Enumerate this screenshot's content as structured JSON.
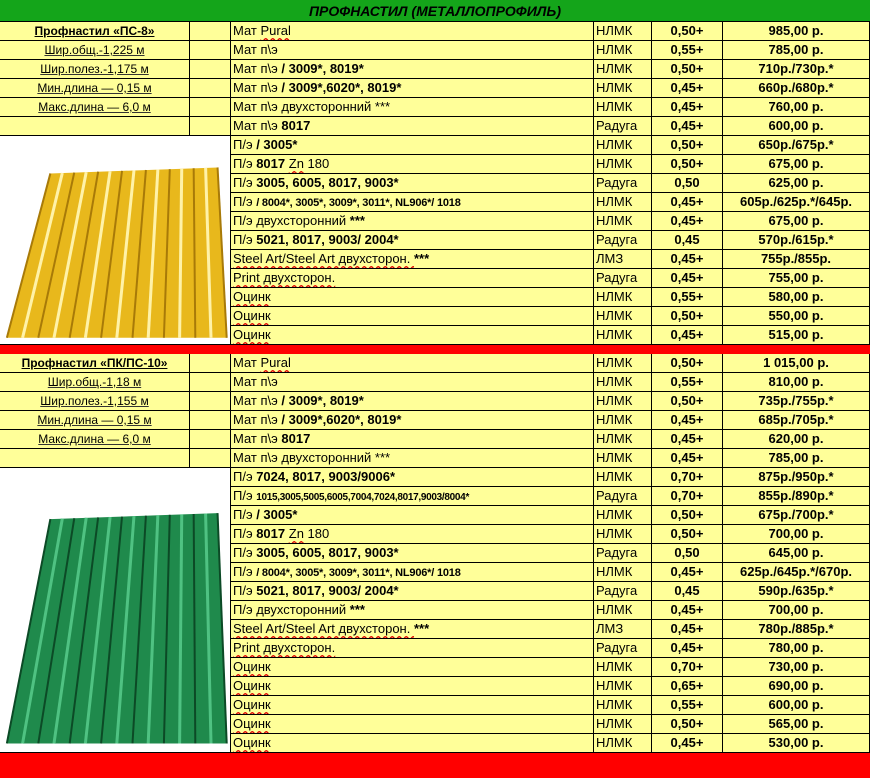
{
  "title": "ПРОФНАСТИЛ (МЕТАЛЛОПРОФИЛЬ)",
  "colors": {
    "green_header": "#14a51a",
    "cell_bg": "#ffff99",
    "separator": "#ff0000",
    "ps8_sheet": "#e8b81c",
    "pk10_sheet": "#1f8a4c"
  },
  "section1": {
    "params": [
      "Профнастил «ПС-8»",
      "Шир.общ.-1,225 м",
      "Шир.полез.-1,175 м",
      "Мин.длина — 0,15 м",
      "Макс.длина — 6,0 м"
    ],
    "image_icon": "yellow-corrugated-sheet",
    "rows": [
      {
        "p": "Мат ",
        "pu": "Pural",
        "b": "",
        "v": "НЛМК",
        "t": "0,50+",
        "price": "985,00 р."
      },
      {
        "p": "Мат п\\э",
        "b": "",
        "v": "НЛМК",
        "t": "0,55+",
        "price": "785,00 р."
      },
      {
        "p": "Мат п\\э ",
        "b": "/ 3009*, 8019*",
        "v": "НЛМК",
        "t": "0,50+",
        "price": "710р./730р.*"
      },
      {
        "p": "Мат п\\э ",
        "b": "/ 3009*,6020*, 8019*",
        "v": "НЛМК",
        "t": "0,45+",
        "price": "660р./680р.*"
      },
      {
        "p": "Мат п\\э двухсторонний ***",
        "b": "",
        "v": "НЛМК",
        "t": "0,45+",
        "price": "760,00 р."
      },
      {
        "p": "Мат п\\э ",
        "b": "8017",
        "v": "Радуга",
        "t": "0,45+",
        "price": "600,00 р."
      },
      {
        "p": "П/э ",
        "b": "/ 3005*",
        "v": "НЛМК",
        "t": "0,50+",
        "price": "650р./675р.*"
      },
      {
        "p": "П/э ",
        "b": "8017",
        "zn": "Zn",
        "tail": " 180",
        "v": "НЛМК",
        "t": "0,50+",
        "price": "675,00 р."
      },
      {
        "p": "П/э ",
        "b": "3005, 6005, 8017, 9003*",
        "v": "Радуга",
        "t": "0,50",
        "price": "625,00 р."
      },
      {
        "p": "П/э ",
        "b": "/ 8004*, 3005*, 3009*, 3011*, NL906*/ 1018",
        "small": true,
        "v": "НЛМК",
        "t": "0,45+",
        "price": "605р./625р.*/645р."
      },
      {
        "p": "П/э двухсторонний ",
        "b": "***",
        "v": "НЛМК",
        "t": "0,45+",
        "price": "675,00 р."
      },
      {
        "p": "П/э ",
        "b": "5021, 8017, 9003/ 2004*",
        "v": "Радуга",
        "t": "0,45",
        "price": "570р./615р.*"
      },
      {
        "p": "Steel Art/Steel Art двухсторон. ",
        "b": "***",
        "sq": true,
        "v": "ЛМЗ",
        "t": "0,45+",
        "price": "755р./855р."
      },
      {
        "p": "Print двухсторон.",
        "b": "",
        "sq": true,
        "v": "Радуга",
        "t": "0,45+",
        "price": "755,00 р."
      },
      {
        "p": "Оцинк",
        "b": "",
        "sq": true,
        "v": "НЛМК",
        "t": "0,55+",
        "price": "580,00 р."
      },
      {
        "p": "Оцинк",
        "b": "",
        "sq": true,
        "v": "НЛМК",
        "t": "0,50+",
        "price": "550,00 р."
      },
      {
        "p": "Оцинк",
        "b": "",
        "sq": true,
        "v": "НЛМК",
        "t": "0,45+",
        "price": "515,00 р."
      }
    ]
  },
  "section2": {
    "params": [
      "Профнастил «ПК/ПС-10»",
      "Шир.общ.-1,18 м",
      "Шир.полез.-1,155 м",
      "Мин.длина — 0,15 м",
      "Макс.длина — 6,0 м"
    ],
    "image_icon": "green-corrugated-sheet",
    "rows": [
      {
        "p": "Мат ",
        "pu": "Pural",
        "b": "",
        "v": "НЛМК",
        "t": "0,50+",
        "price": "1 015,00 р."
      },
      {
        "p": "Мат п\\э",
        "b": "",
        "v": "НЛМК",
        "t": "0,55+",
        "price": "810,00 р."
      },
      {
        "p": "Мат п\\э ",
        "b": "/ 3009*, 8019*",
        "v": "НЛМК",
        "t": "0,50+",
        "price": "735р./755р.*"
      },
      {
        "p": "Мат п\\э ",
        "b": "/ 3009*,6020*, 8019*",
        "v": "НЛМК",
        "t": "0,45+",
        "price": "685р./705р.*"
      },
      {
        "p": "Мат п\\э ",
        "b": "8017",
        "v": "НЛМК",
        "t": "0,45+",
        "price": "620,00 р."
      },
      {
        "p": "Мат п\\э двухсторонний ***",
        "b": "",
        "v": "НЛМК",
        "t": "0,45+",
        "price": "785,00 р."
      },
      {
        "p": "П/э ",
        "b": "7024, 8017, 9003/9006*",
        "v": "НЛМК",
        "t": "0,70+",
        "price": "875р./950р.*"
      },
      {
        "p": "П/э ",
        "b": "1015,3005,5005,6005,7004,7024,8017,9003/8004*",
        "tiny": true,
        "v": "Радуга",
        "t": "0,70+",
        "price": "855р./890р.*"
      },
      {
        "p": "П/э ",
        "b": "/ 3005*",
        "v": "НЛМК",
        "t": "0,50+",
        "price": "675р./700р.*"
      },
      {
        "p": "П/э ",
        "b": "8017",
        "zn": "Zn",
        "tail": " 180",
        "v": "НЛМК",
        "t": "0,50+",
        "price": "700,00 р."
      },
      {
        "p": "П/э ",
        "b": "3005, 6005, 8017, 9003*",
        "v": "Радуга",
        "t": "0,50",
        "price": "645,00 р."
      },
      {
        "p": "П/э ",
        "b": "/ 8004*, 3005*, 3009*, 3011*, NL906*/ 1018",
        "small": true,
        "v": "НЛМК",
        "t": "0,45+",
        "price": "625р./645р.*/670р."
      },
      {
        "p": "П/э ",
        "b": "5021, 8017, 9003/ 2004*",
        "v": "Радуга",
        "t": "0,45",
        "price": "590р./635р.*"
      },
      {
        "p": "П/э двухсторонний ",
        "b": "***",
        "v": "НЛМК",
        "t": "0,45+",
        "price": "700,00 р."
      },
      {
        "p": "Steel Art/Steel Art двухсторон. ",
        "b": "***",
        "sq": true,
        "v": "ЛМЗ",
        "t": "0,45+",
        "price": "780р./885р.*"
      },
      {
        "p": "Print двухсторон.",
        "b": "",
        "sq": true,
        "v": "Радуга",
        "t": "0,45+",
        "price": "780,00 р."
      },
      {
        "p": "Оцинк",
        "b": "",
        "sq": true,
        "v": "НЛМК",
        "t": "0,70+",
        "price": "730,00 р."
      },
      {
        "p": "Оцинк",
        "b": "",
        "sq": true,
        "v": "НЛМК",
        "t": "0,65+",
        "price": "690,00 р."
      },
      {
        "p": "Оцинк",
        "b": "",
        "sq": true,
        "v": "НЛМК",
        "t": "0,55+",
        "price": "600,00 р."
      },
      {
        "p": "Оцинк",
        "b": "",
        "sq": true,
        "v": "НЛМК",
        "t": "0,50+",
        "price": "565,00 р."
      },
      {
        "p": "Оцинк",
        "b": "",
        "sq": true,
        "v": "НЛМК",
        "t": "0,45+",
        "price": "530,00 р."
      }
    ]
  }
}
